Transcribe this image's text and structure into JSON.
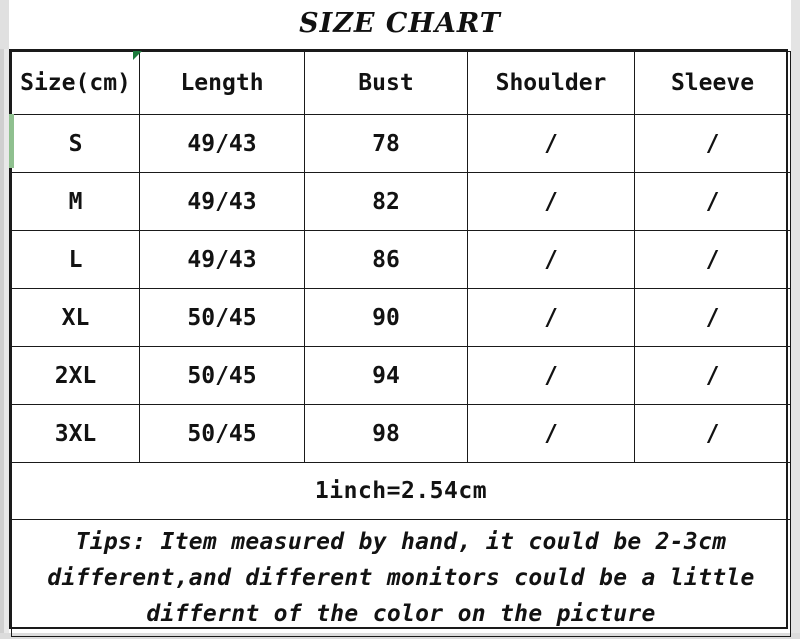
{
  "title": "SIZE CHART",
  "table": {
    "columns": [
      "Size(cm)",
      "Length",
      "Bust",
      "Shoulder",
      "Sleeve"
    ],
    "rows": [
      {
        "size": "S",
        "length": "49/43",
        "bust": "78",
        "shoulder": "/",
        "sleeve": "/"
      },
      {
        "size": "M",
        "length": "49/43",
        "bust": "82",
        "shoulder": "/",
        "sleeve": "/"
      },
      {
        "size": "L",
        "length": "49/43",
        "bust": "86",
        "shoulder": "/",
        "sleeve": "/"
      },
      {
        "size": "XL",
        "length": "50/45",
        "bust": "90",
        "shoulder": "/",
        "sleeve": "/"
      },
      {
        "size": "2XL",
        "length": "50/45",
        "bust": "94",
        "shoulder": "/",
        "sleeve": "/"
      },
      {
        "size": "3XL",
        "length": "50/45",
        "bust": "98",
        "shoulder": "/",
        "sleeve": "/"
      }
    ],
    "conversion_note": "1inch=2.54cm",
    "tips": [
      "Tips: Item measured by hand, it could be 2-3cm",
      "different,and different monitors could be a little",
      "differnt of the color on the picture"
    ]
  },
  "colors": {
    "border": "#1a1a1a",
    "text": "#121212",
    "background": "#ffffff",
    "accent_green": "#8fc08f",
    "accent_green_dark": "#1c7a3c",
    "edge_gray": "#e0e0e0"
  }
}
